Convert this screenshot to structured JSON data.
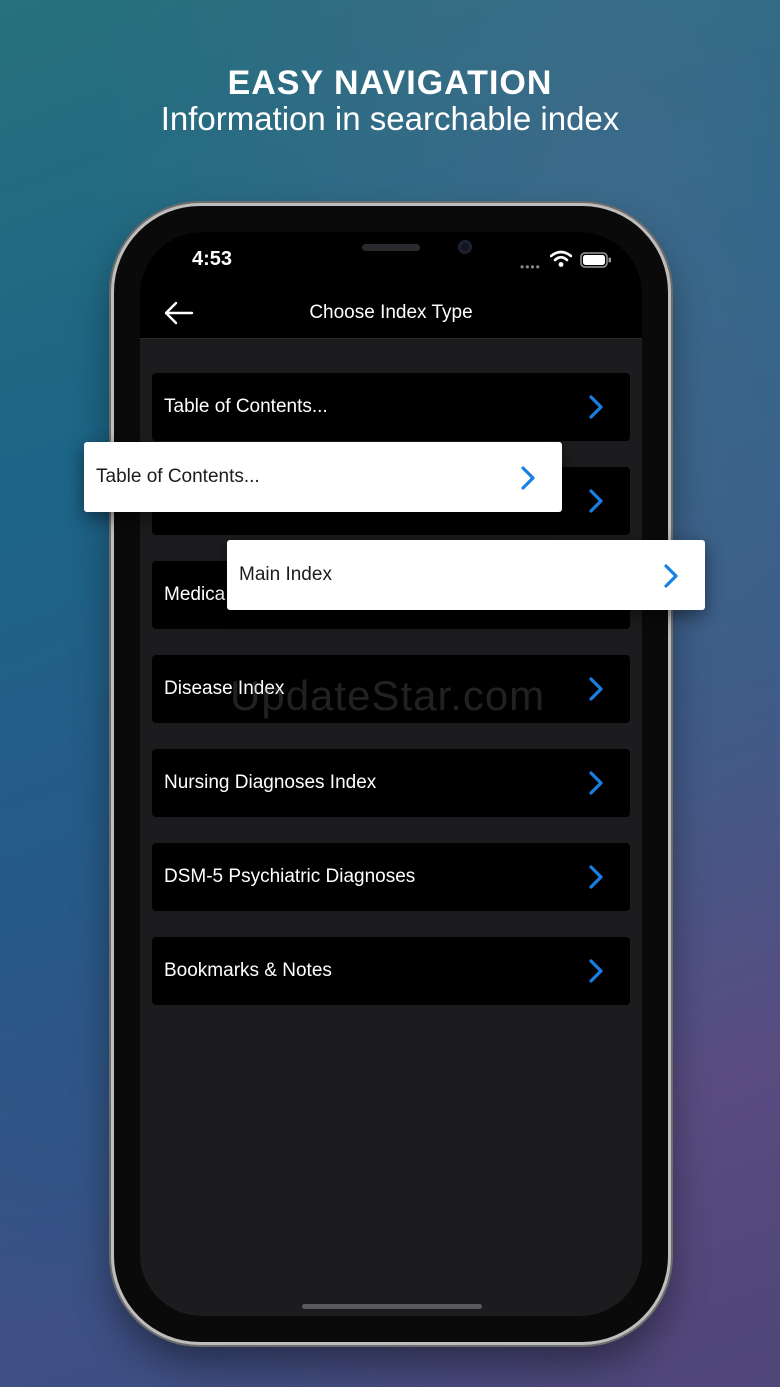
{
  "promo": {
    "headline": "EASY NAVIGATION",
    "subline": "Information in searchable index"
  },
  "status_bar": {
    "time": "4:53"
  },
  "nav": {
    "title": "Choose Index Type"
  },
  "list": {
    "items": [
      {
        "label": "Table of Contents..."
      },
      {
        "label": ""
      },
      {
        "label": "Medica"
      },
      {
        "label": "Disease Index"
      },
      {
        "label": "Nursing Diagnoses Index"
      },
      {
        "label": "DSM-5 Psychiatric Diagnoses"
      },
      {
        "label": "Bookmarks & Notes"
      }
    ]
  },
  "callouts": {
    "table_of_contents": "Table of Contents...",
    "main_index": "Main Index"
  },
  "watermark": "UpdateStar.com",
  "colors": {
    "accent": "#1a7fe3",
    "row_background": "#000000",
    "screen_background": "#1c1c1e"
  },
  "icons": {
    "back": "arrow-left-icon",
    "chevron": "chevron-right-icon",
    "wifi": "wifi-icon",
    "battery": "battery-icon"
  }
}
